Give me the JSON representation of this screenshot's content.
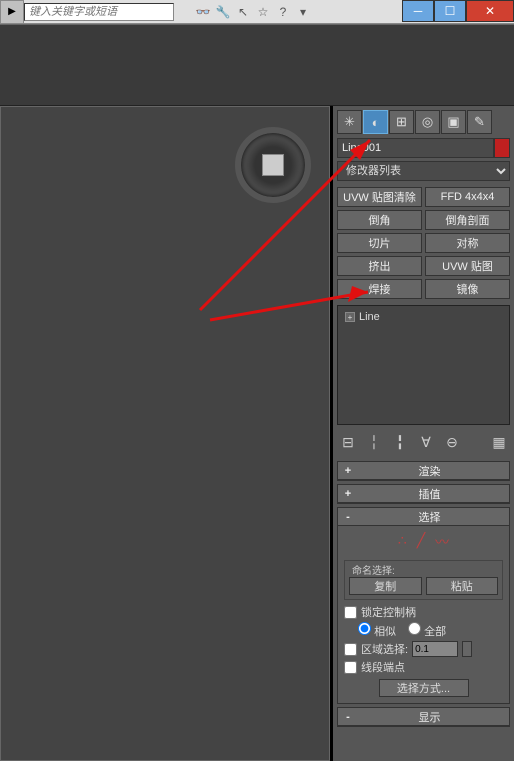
{
  "top": {
    "search_placeholder": "键入关键字或短语"
  },
  "object_name": "Line001",
  "modifier_list_label": "修改器列表",
  "modifiers": {
    "uvw_clear": "UVW 贴图清除",
    "ffd": "FFD 4x4x4",
    "chamfer": "倒角",
    "chamfer_profile": "倒角剖面",
    "slice": "切片",
    "symmetry": "对称",
    "extrude": "挤出",
    "uvw_map": "UVW 贴图",
    "weld": "焊接",
    "mirror": "镜像"
  },
  "stack": {
    "item": "Line"
  },
  "rollups": {
    "render": "渲染",
    "interp": "插值",
    "select": "选择",
    "display": "显示"
  },
  "selection": {
    "named_label": "命名选择:",
    "copy": "复制",
    "paste": "粘贴",
    "lock_handles": "锁定控制柄",
    "similar": "相似",
    "all": "全部",
    "region_select": "区域选择:",
    "region_value": "0.1",
    "segment_end": "线段端点",
    "select_method": "选择方式..."
  }
}
